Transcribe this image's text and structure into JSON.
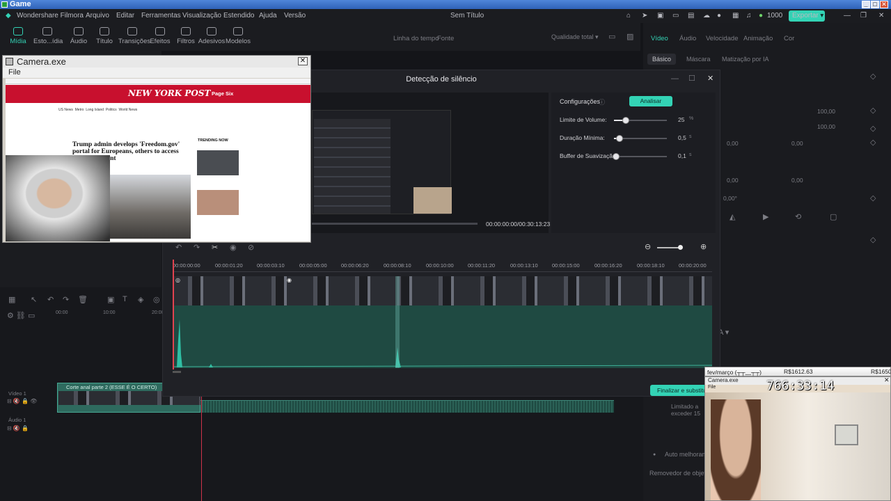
{
  "xp_title": "Game",
  "filmora": {
    "app_name": "Wondershare Filmora",
    "menu": [
      "Arquivo",
      "Editar",
      "Ferramentas",
      "Visualização",
      "Estendido",
      "Ajuda",
      "Versão"
    ],
    "project_title": "Sem Título",
    "credits": "1000",
    "export_label": "Exportar",
    "toolbar": [
      "Mídia",
      "Esto...ídia",
      "Áudio",
      "Título",
      "Transições",
      "Efeitos",
      "Filtros",
      "Adesivos",
      "Modelos"
    ],
    "preview_header": {
      "timeline_label": "Linha do tempo",
      "source_label": "Fonte",
      "quality": "Qualidade total"
    },
    "right_tabs": [
      "Vídeo",
      "Áudio",
      "Velocidade",
      "Animação",
      "Cor"
    ],
    "right_subtabs": [
      "Básico",
      "Máscara",
      "Matização por IA"
    ],
    "right_values": [
      "100,00",
      "100,00",
      "0,00",
      "0,00",
      "0,00",
      "0,00",
      "0,00°"
    ],
    "right_bottom": {
      "limit_text_1": "Limitado a",
      "limit_text_2": "exceder 15",
      "auto_label": "Auto melhoram",
      "remover_label": "Removedor de objeto"
    },
    "timeline": {
      "clip_label": "Corte anal parte 2 (ESSE É O CERTO)",
      "track_video": "Vídeo 1",
      "track_audio": "Áudio 1",
      "left_ruler": [
        "00:00",
        "10:00",
        "20:00"
      ]
    }
  },
  "silence_dialog": {
    "title": "Detecção de silêncio",
    "config_label": "Configurações",
    "analyze_label": "Analisar",
    "params": [
      {
        "label": "Limite de Volume:",
        "value": "25",
        "unit": "%",
        "level": 0.22
      },
      {
        "label": "Duração Mínima:",
        "value": "0,5",
        "unit": "s",
        "level": 0.1
      },
      {
        "label": "Buffer de Suavização:",
        "value": "0,1",
        "unit": "s",
        "level": 0.04
      }
    ],
    "timecode": "00:00:00:00/00:30:13:23",
    "ruler": [
      "00:00:00:00",
      "00:00:01:20",
      "00:00:03:10",
      "00:00:05:00",
      "00:00:06:20",
      "00:00:08:10",
      "00:00:10:00",
      "00:00:11:20",
      "00:00:13:10",
      "00:00:15:00",
      "00:00:16:20",
      "00:00:18:10",
      "00:00:20:00"
    ],
    "finish_label": "Finalizar e substituir"
  },
  "camera1": {
    "title": "Camera.exe",
    "menu_file": "File",
    "web": {
      "site": "NEW YORK POST",
      "pagesix": "Page Six",
      "headline": "Trump admin develops 'Freedom.gov' portal for Europeans, others to access banned content",
      "trending": "TRENDING NOW",
      "nav": [
        "US News",
        "Metro",
        "Long Island",
        "Politics",
        "World News"
      ]
    }
  },
  "overlay": {
    "goal_label": "fev/março (┬┬﹏┬┬)",
    "amount1": "R$1612.63",
    "amount2": "R$1650",
    "cam_title": "Camera.exe",
    "cam_menu": "File",
    "timer": "766:33:14"
  },
  "colors": {
    "accent": "#33d3b5",
    "xp_blue": "#3a6fc8",
    "nypost_red": "#c8102e"
  }
}
